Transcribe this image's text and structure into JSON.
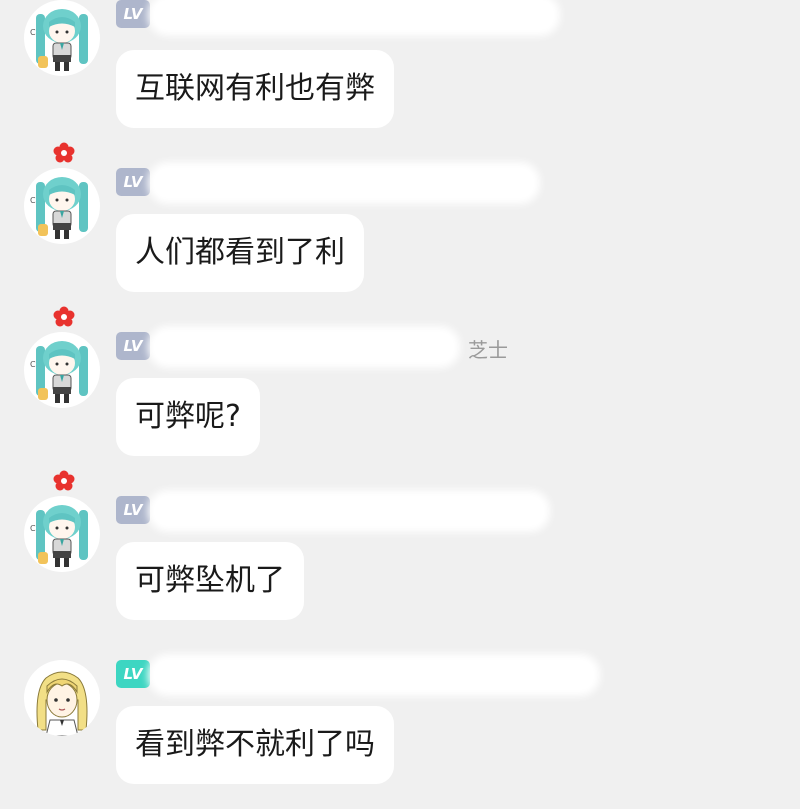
{
  "messages": [
    {
      "badge": "LV",
      "badge_color": "#aeb6cc",
      "flower": false,
      "avatar": "miku-icon",
      "name_tail": "",
      "text": "互联网有利也有弊"
    },
    {
      "badge": "LV",
      "badge_color": "#aeb6cc",
      "flower": true,
      "avatar": "miku-icon",
      "name_tail": "",
      "text": "人们都看到了利"
    },
    {
      "badge": "LV",
      "badge_color": "#aeb6cc",
      "flower": true,
      "avatar": "miku-icon",
      "name_tail": "芝士",
      "text": "可弊呢?"
    },
    {
      "badge": "LV",
      "badge_color": "#aeb6cc",
      "flower": true,
      "avatar": "miku-icon",
      "name_tail": "",
      "text": "可弊坠机了"
    },
    {
      "badge": "LV",
      "badge_color": "#3dd6c2",
      "flower": false,
      "avatar": "blonde-girl-icon",
      "name_tail": "",
      "text": "看到弊不就利了吗"
    }
  ]
}
